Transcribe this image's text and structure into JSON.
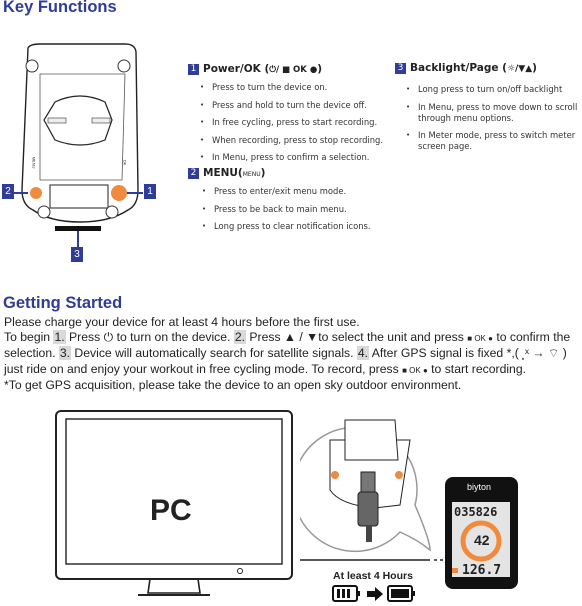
{
  "key_functions": {
    "title": "Key Functions",
    "callouts": [
      "1",
      "2",
      "3"
    ],
    "device_labels": {
      "menu": "MENU",
      "ok": "OK"
    },
    "sections": [
      {
        "num": "1",
        "title": "Power/OK (",
        "title_symbols": "⏻/ ■ OK ●",
        "title_end": ")",
        "bullets": [
          "Press to turn the device on.",
          "Press and hold to turn the device off.",
          "In free cycling, press to start recording.",
          "When recording, press to stop recording.",
          "In Menu, press to confirm a selection."
        ]
      },
      {
        "num": "2",
        "title": "MENU(",
        "title_symbols": "MENU",
        "title_end": ")",
        "bullets": [
          "Press to enter/exit menu mode.",
          "Press to be back to main menu.",
          "Long press to clear notification icons."
        ]
      },
      {
        "num": "3",
        "title": "Backlight/Page (",
        "title_symbols": "☼/▼▲",
        "title_end": ")",
        "bullets": [
          "Long press to turn on/off backlight",
          "In Menu, press to move down to scroll through menu options.",
          "In Meter mode, press to switch meter screen page."
        ]
      }
    ]
  },
  "getting_started": {
    "title": "Getting Started",
    "line1": "Please charge your device for at least 4 hours before the first use.",
    "p_begin": "To begin ",
    "s1": "1.",
    "p_press": " Press ",
    "power_sym": "⏻",
    "p_turn_on": " to turn on the device. ",
    "s2": "2.",
    "p_press2": " Press ▲ / ▼to select the unit and press ",
    "ok_sym": "■ OK ●",
    "p_confirm": " to confirm the selection. ",
    "s3": "3.",
    "p_search": " Device will automatically search for satellite signals. ",
    "s4": "4.",
    "p_fixed": " After GPS signal is fixed *,( ",
    "gps_sym": "⸼ˣ → ⌔",
    "p_ride": " ) just ride on and enjoy your workout in free cycling mode. To record, press ",
    "ok_sym2": "■ OK ●",
    "p_record": " to start recording.",
    "note": "*To get GPS acquisition, please take the device to an open sky outdoor environment."
  },
  "illustration": {
    "pc_label": "PC",
    "brand": "biyton",
    "screen_top": "035826",
    "screen_mid": "42",
    "screen_bottom": "126.7",
    "charge_label": "At least 4 Hours",
    "accent": "#f08a3c"
  }
}
